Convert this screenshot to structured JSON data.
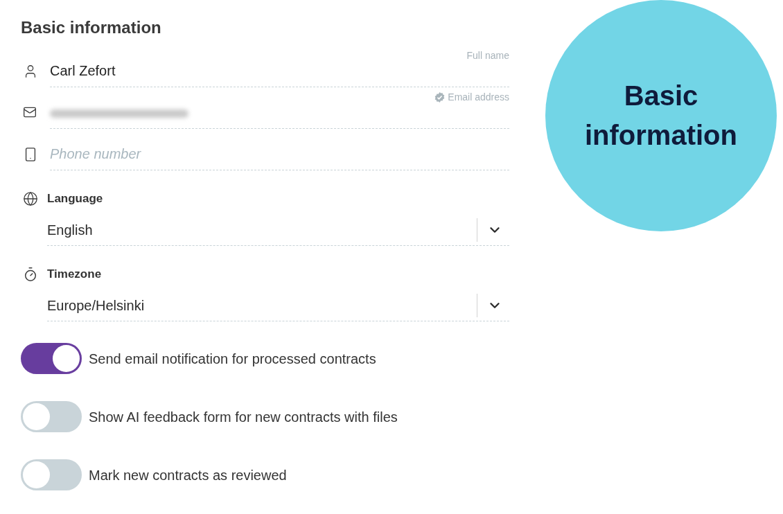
{
  "title": "Basic information",
  "fields": [
    {
      "kind": "text",
      "label": "Full name",
      "value": "Carl Zefort"
    },
    {
      "kind": "redacted",
      "label": "Email address",
      "verified": true
    },
    {
      "kind": "text",
      "placeholder": "Phone number"
    }
  ],
  "selects": [
    {
      "label": "Language",
      "value": "English"
    },
    {
      "label": "Timezone",
      "value": "Europe/Helsinki"
    }
  ],
  "toggles": [
    {
      "label": "Send email notification for processed contracts",
      "on": true
    },
    {
      "label": "Show AI feedback form for new contracts with files",
      "on": false
    },
    {
      "label": "Mark new contracts as reviewed",
      "on": false
    }
  ],
  "badge": {
    "text": "Basic information"
  }
}
